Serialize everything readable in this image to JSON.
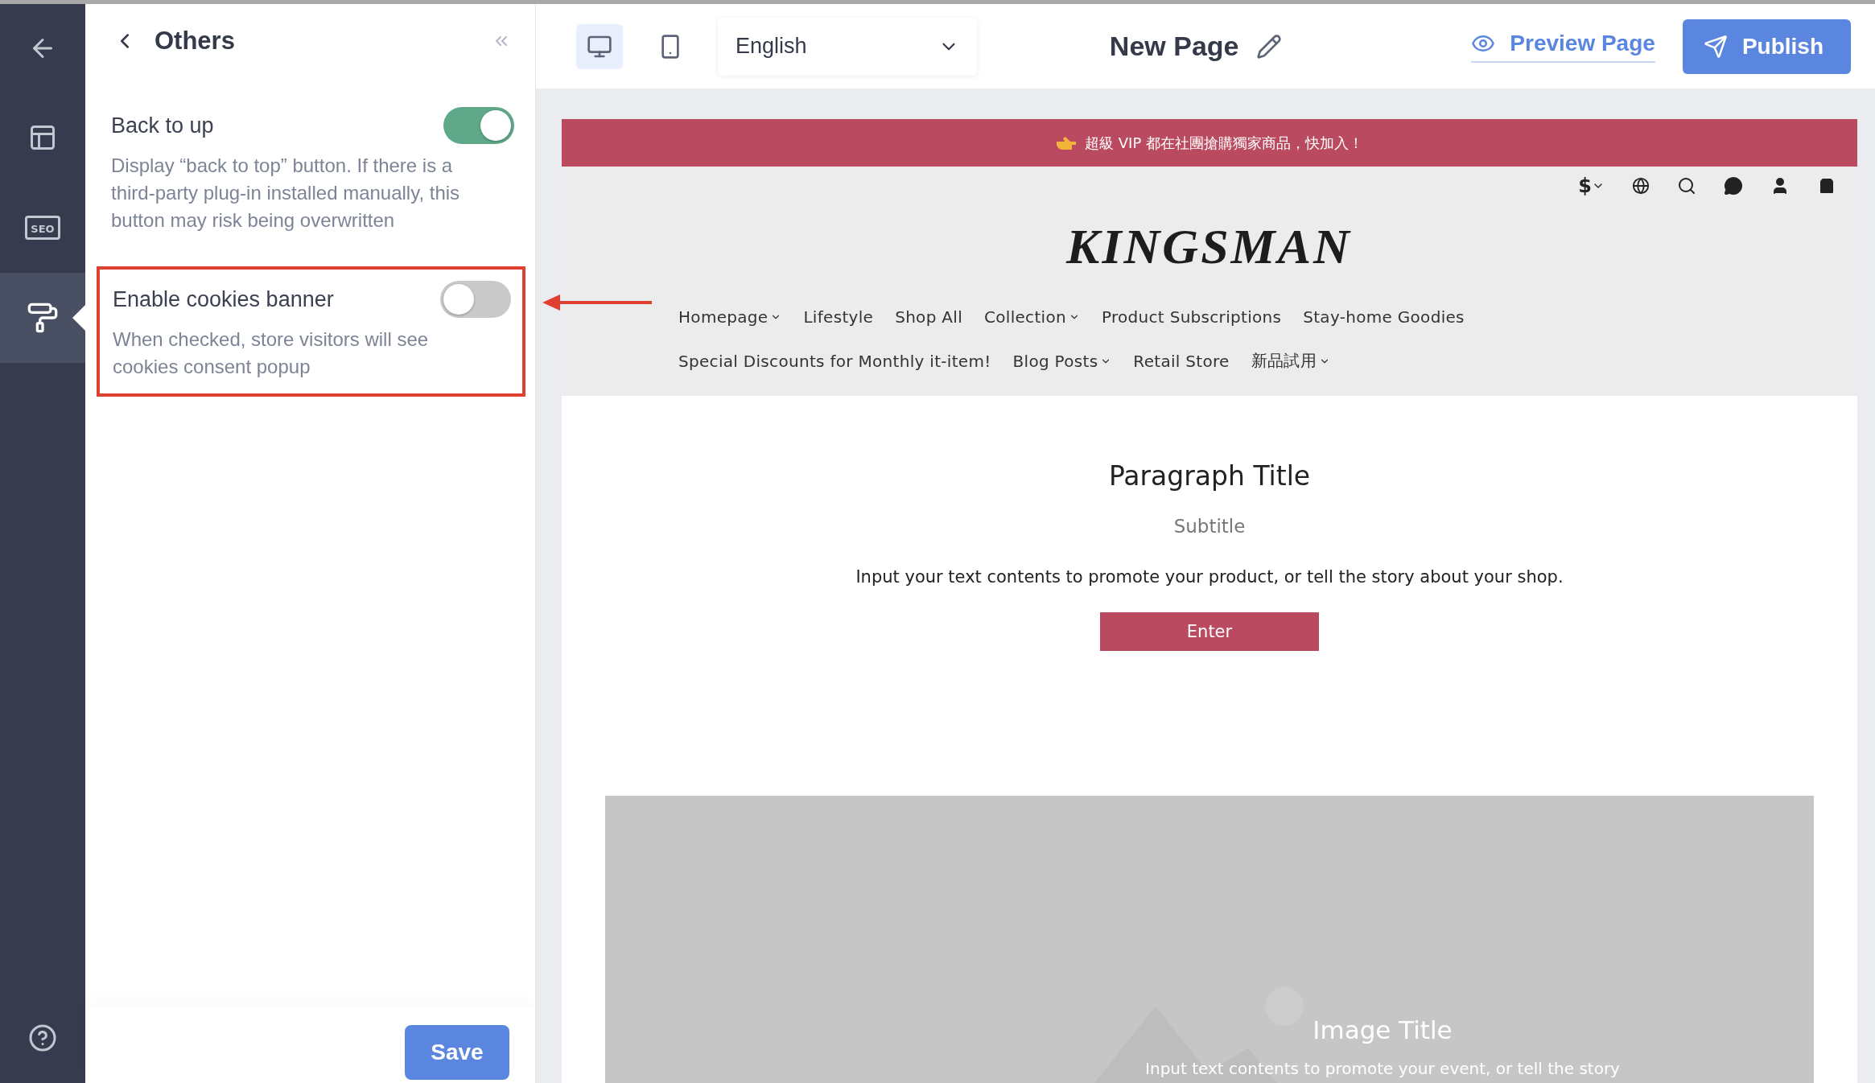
{
  "rail": {
    "items": [
      {
        "kind": "back",
        "selected": false
      },
      {
        "kind": "layout",
        "selected": false
      },
      {
        "kind": "seo",
        "selected": false,
        "label": "SEO"
      },
      {
        "kind": "theme",
        "selected": true
      }
    ],
    "help": true
  },
  "panel": {
    "title": "Others",
    "settings": [
      {
        "label": "Back to up",
        "description": "Display “back to top” button. If there is a third-party plug-in installed manually, this button may risk being overwritten",
        "on": true,
        "highlighted": false
      },
      {
        "label": "Enable cookies banner",
        "description": "When checked, store visitors will see cookies consent popup",
        "on": false,
        "highlighted": true
      }
    ],
    "save_button": "Save"
  },
  "toolbar": {
    "devices": [
      {
        "kind": "desktop",
        "selected": true
      },
      {
        "kind": "mobile",
        "selected": false
      }
    ],
    "language": "English",
    "page_title": "New Page",
    "preview_button": "Preview Page",
    "publish_button": "Publish"
  },
  "store": {
    "announcement": "超級 VIP 都在社團搶購獨家商品，快加入！",
    "currency": "$",
    "logo": "KINGSMAN",
    "nav_rows": [
      {
        "items": [
          {
            "label": "Homepage",
            "dropdown": true
          },
          {
            "label": "Lifestyle",
            "dropdown": false
          },
          {
            "label": "Shop All",
            "dropdown": false
          },
          {
            "label": "Collection",
            "dropdown": true
          },
          {
            "label": "Product Subscriptions",
            "dropdown": false
          },
          {
            "label": "Stay-home Goodies",
            "dropdown": false
          }
        ]
      },
      {
        "items": [
          {
            "label": "Special Discounts for Monthly it-item!",
            "dropdown": false
          },
          {
            "label": "Blog Posts",
            "dropdown": true
          },
          {
            "label": "Retail Store",
            "dropdown": false
          },
          {
            "label": "新品試用",
            "dropdown": true
          }
        ]
      }
    ],
    "section": {
      "title": "Paragraph Title",
      "subtitle": "Subtitle",
      "body": "Input your text contents to promote your product, or tell the story about your shop.",
      "button": "Enter"
    },
    "image_block": {
      "title": "Image Title",
      "text": "Input text contents to promote your event, or tell the story"
    }
  }
}
